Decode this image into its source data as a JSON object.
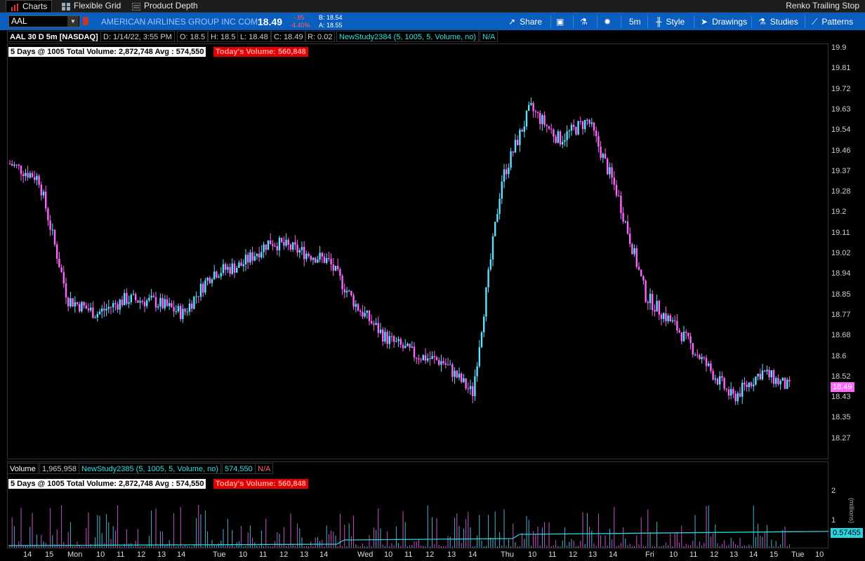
{
  "tabs": {
    "charts": "Charts",
    "flexible_grid": "Flexible Grid",
    "product_depth": "Product Depth",
    "right_study": "Renko Trailing Stop"
  },
  "toolbar": {
    "symbol": "AAL",
    "company": "AMERICAN AIRLINES GROUP INC COM",
    "last": "18.49",
    "change": "-.85",
    "change_pct": "-4.40%",
    "bid": "B: 18.54",
    "ask": "A: 18.55",
    "share": "Share",
    "interval": "5m",
    "style": "Style",
    "drawings": "Drawings",
    "studies": "Studies",
    "patterns": "Patterns"
  },
  "info": {
    "title": "AAL 30 D 5m [NASDAQ]",
    "date": "D: 1/14/22, 3:55 PM",
    "open": "O: 18.5",
    "high": "H: 18.5",
    "low": "L: 18.48",
    "close": "C: 18.49",
    "range": "R: 0.02",
    "study": "NewStudy2384 (5, 1005, 5, Volume, no)",
    "study_val": "N/A"
  },
  "price_label": {
    "summary": "5 Days @ 1005 Total Volume: 2,872,748   Avg : 574,550",
    "today": "Today's Volume: 560,848",
    "current": "18.49"
  },
  "volume_info": {
    "label": "Volume",
    "value": "1,965,958",
    "study": "NewStudy2385 (5, 1005, 5, Volume, no)",
    "study_val": "574,550",
    "na": "N/A",
    "summary": "5 Days @ 1005 Total Volume: 2,872,748   Avg : 574,550",
    "today": "Today's Volume: 560,848",
    "avg_tag": "0.57455",
    "unit": "(millions)"
  },
  "price_axis": [
    "19.9",
    "19.81",
    "19.72",
    "19.63",
    "19.54",
    "19.46",
    "19.37",
    "19.28",
    "19.2",
    "19.11",
    "19.02",
    "18.94",
    "18.85",
    "18.77",
    "18.68",
    "18.6",
    "18.52",
    "18.43",
    "18.35",
    "18.27"
  ],
  "volume_axis": [
    "2",
    "1"
  ],
  "time_axis": [
    "14",
    "15",
    "Mon",
    "10",
    "11",
    "12",
    "13",
    "14",
    "Tue",
    "10",
    "11",
    "12",
    "13",
    "14",
    "Wed",
    "10",
    "11",
    "12",
    "13",
    "14",
    "Thu",
    "10",
    "11",
    "12",
    "13",
    "14",
    "Fri",
    "10",
    "11",
    "12",
    "13",
    "14",
    "15",
    "Tue",
    "10"
  ],
  "colors": {
    "toolbar": "#0a5ebd",
    "up": "#5ee0ff",
    "down": "#ff66ff",
    "avg_line": "#29d3e0",
    "today_box": "#e00000"
  },
  "chart_data": {
    "type": "candlestick",
    "interval": "5m",
    "ylim": [
      18.27,
      19.9
    ],
    "volume_ylim_millions": [
      0,
      2
    ],
    "volume_avg_millions": 0.57455,
    "close_path": [
      {
        "x": "Fri 14",
        "y": 19.42
      },
      {
        "x": "Fri 15",
        "y": 19.36
      },
      {
        "x": "Mon 10",
        "y": 18.86
      },
      {
        "x": "Mon 11",
        "y": 18.8
      },
      {
        "x": "Mon 12",
        "y": 18.86
      },
      {
        "x": "Mon 13",
        "y": 18.85
      },
      {
        "x": "Mon 14",
        "y": 18.8
      },
      {
        "x": "Tue 10",
        "y": 18.97
      },
      {
        "x": "Tue 11",
        "y": 19.0
      },
      {
        "x": "Tue 12",
        "y": 19.1
      },
      {
        "x": "Tue 13",
        "y": 19.06
      },
      {
        "x": "Tue 14",
        "y": 19.02
      },
      {
        "x": "Wed 10",
        "y": 18.83
      },
      {
        "x": "Wed 11",
        "y": 18.7
      },
      {
        "x": "Wed 12",
        "y": 18.63
      },
      {
        "x": "Wed 13",
        "y": 18.6
      },
      {
        "x": "Wed 14",
        "y": 18.47
      },
      {
        "x": "Thu 10",
        "y": 19.35
      },
      {
        "x": "Thu 11",
        "y": 19.65
      },
      {
        "x": "Thu 12",
        "y": 19.52
      },
      {
        "x": "Thu 13",
        "y": 19.6
      },
      {
        "x": "Thu 14",
        "y": 19.3
      },
      {
        "x": "Fri 10",
        "y": 18.87
      },
      {
        "x": "Fri 11",
        "y": 18.75
      },
      {
        "x": "Fri 12",
        "y": 18.6
      },
      {
        "x": "Fri 13",
        "y": 18.45
      },
      {
        "x": "Fri 14",
        "y": 18.56
      },
      {
        "x": "Fri 15",
        "y": 18.49
      }
    ]
  }
}
